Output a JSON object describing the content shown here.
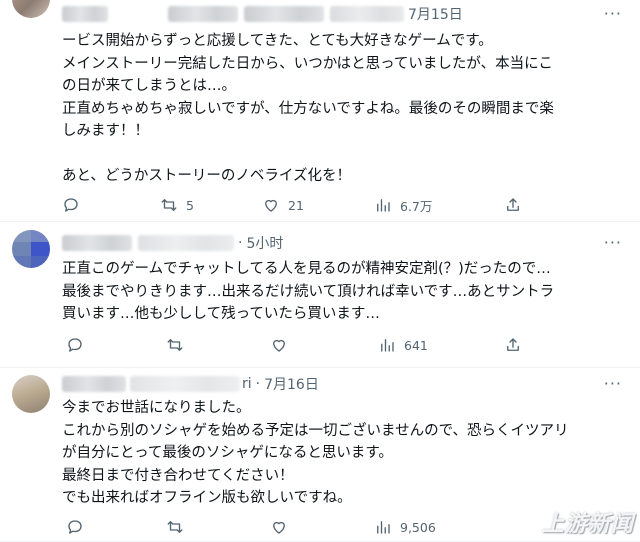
{
  "tweets": [
    {
      "date": "7月15日",
      "lines": [
        "ービス開始からずっと応援してきた、とても大好きなゲームです。",
        "メインストーリー完結した日から、いつかはと思っていましたが、本当にこ",
        "の日が来てしまうとは…。",
        "正直めちゃめちゃ寂しいですが、仕方ないですよね。最後のその瞬間まで楽",
        "しみます！！",
        "",
        "あと、どうかストーリーのノベライズ化を！"
      ],
      "replies": "",
      "retweets": "5",
      "likes": "21",
      "views": "6.7万"
    },
    {
      "date": "5小时",
      "lines": [
        "正直このゲームでチャットしてる人を見るのが精神安定剤(？)だったので…",
        "最後までやりきります…出来るだけ続いて頂ければ幸いです…あとサントラ",
        "買います…他も少しして残っていたら買います…"
      ],
      "replies": "",
      "retweets": "",
      "likes": "",
      "views": "641"
    },
    {
      "date": "7月16日",
      "name_tail": "ri",
      "lines": [
        "今までお世話になりました。",
        "これから別のソシャゲを始める予定は一切ございませんので、恐らくイツアリ",
        "が自分にとって最後のソシャゲになると思います。",
        "最終日まで付き合わせてください！",
        "でも出来ればオフライン版も欲しいですね。"
      ],
      "replies": "",
      "retweets": "",
      "likes": "",
      "views": "9,506"
    }
  ],
  "more_glyph": "···",
  "icons": [
    "reply-icon",
    "retweet-icon",
    "like-icon",
    "views-icon",
    "share-icon",
    "more-icon"
  ],
  "watermark": "上游新闻"
}
